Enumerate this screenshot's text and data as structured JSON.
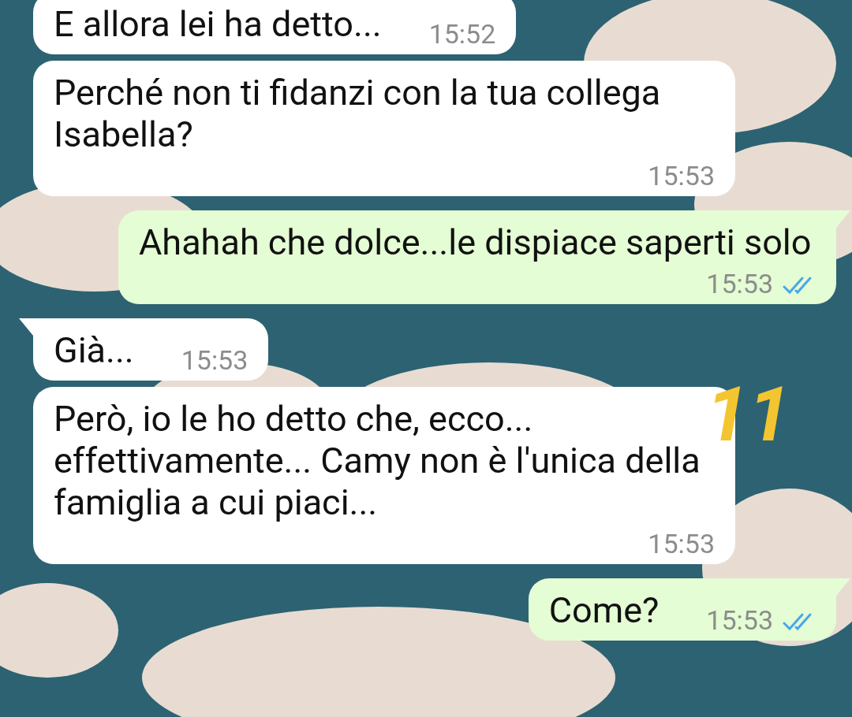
{
  "messages": [
    {
      "kind": "incoming",
      "text": "E allora lei ha detto...",
      "time": "15:52",
      "tail": false
    },
    {
      "kind": "incoming",
      "text": "Perché non ti fidanzi con la tua collega Isabella?",
      "time": "15:53",
      "tail": false
    },
    {
      "kind": "outgoing",
      "text": "Ahahah che dolce...le dispiace saperti solo",
      "time": "15:53",
      "tail": true,
      "read": true
    },
    {
      "kind": "incoming",
      "text": "Già...",
      "time": "15:53",
      "tail": true
    },
    {
      "kind": "incoming",
      "text": "Però, io le ho detto che, ecco... effettivamente... Camy non è l'unica della famiglia a cui piaci...",
      "time": "15:53",
      "tail": false
    },
    {
      "kind": "outgoing",
      "text": "Come?",
      "time": "15:53",
      "tail": true,
      "read": true
    }
  ],
  "annotation": {
    "text": "11",
    "color": "#f3c530"
  }
}
